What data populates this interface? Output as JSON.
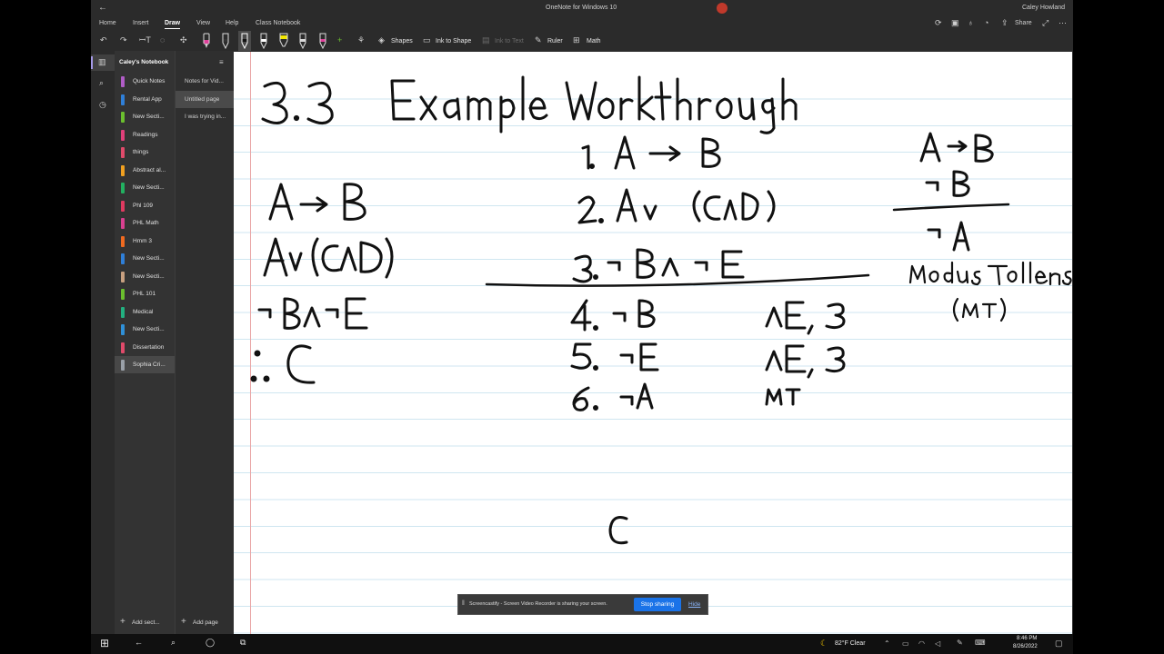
{
  "titlebar": {
    "back_icon": "back-arrow-icon",
    "app_title": "OneNote for Windows 10",
    "user": "Caley Howland"
  },
  "menu": {
    "items": [
      {
        "label": "Home",
        "active": false
      },
      {
        "label": "Insert",
        "active": false
      },
      {
        "label": "Draw",
        "active": true
      },
      {
        "label": "View",
        "active": false
      },
      {
        "label": "Help",
        "active": false
      },
      {
        "label": "Class Notebook",
        "active": false
      }
    ]
  },
  "header_right": {
    "share_label": "Share"
  },
  "ribbon": {
    "shapes_label": "Shapes",
    "ink_to_shape_label": "Ink to Shape",
    "ink_to_text_label": "Ink to Text",
    "ruler_label": "Ruler",
    "math_label": "Math",
    "pens": [
      {
        "color": "#e0409a"
      },
      {
        "color": "#222222"
      },
      {
        "color": "#111111"
      },
      {
        "color": "#ffffff"
      },
      {
        "color": "#f2e600"
      },
      {
        "color": "#d8d8d8"
      },
      {
        "color": "#e0409a"
      }
    ]
  },
  "notebook": {
    "name": "Caley's Notebook",
    "sections": [
      {
        "label": "Quick Notes",
        "color": "#b05cc6"
      },
      {
        "label": "Rental App",
        "color": "#2f7fd8"
      },
      {
        "label": "New Secti...",
        "color": "#6bbf2e"
      },
      {
        "label": "Readings",
        "color": "#e0407a"
      },
      {
        "label": "things",
        "color": "#e04a6a"
      },
      {
        "label": "Abstract al...",
        "color": "#f0a020"
      },
      {
        "label": "New Secti...",
        "color": "#22b060"
      },
      {
        "label": "Phl 109",
        "color": "#e03a60"
      },
      {
        "label": "PHL Math",
        "color": "#d84090"
      },
      {
        "label": "Hmm 3",
        "color": "#f06a20"
      },
      {
        "label": "New Secti...",
        "color": "#2f7fd8"
      },
      {
        "label": "New Secti...",
        "color": "#c8a080"
      },
      {
        "label": "PHL 101",
        "color": "#6bbf2e"
      },
      {
        "label": "Medical",
        "color": "#22b080"
      },
      {
        "label": "New Secti...",
        "color": "#2f90d8"
      },
      {
        "label": "Dissertation",
        "color": "#e04a6a"
      },
      {
        "label": "Sophia Cri...",
        "color": "#9aa0a8"
      }
    ],
    "add_section_label": "Add sect...",
    "pages": [
      {
        "label": "Notes for Vid..."
      },
      {
        "label": "Untitled page"
      },
      {
        "label": "I was trying in..."
      }
    ],
    "add_page_label": "Add page"
  },
  "share_banner": {
    "message": "Screencastify - Screen Video Recorder is sharing your screen.",
    "stop_label": "Stop sharing",
    "hide_label": "Hide"
  },
  "taskbar": {
    "weather": "82°F  Clear",
    "time": "8:46 PM",
    "date": "8/26/2022"
  }
}
